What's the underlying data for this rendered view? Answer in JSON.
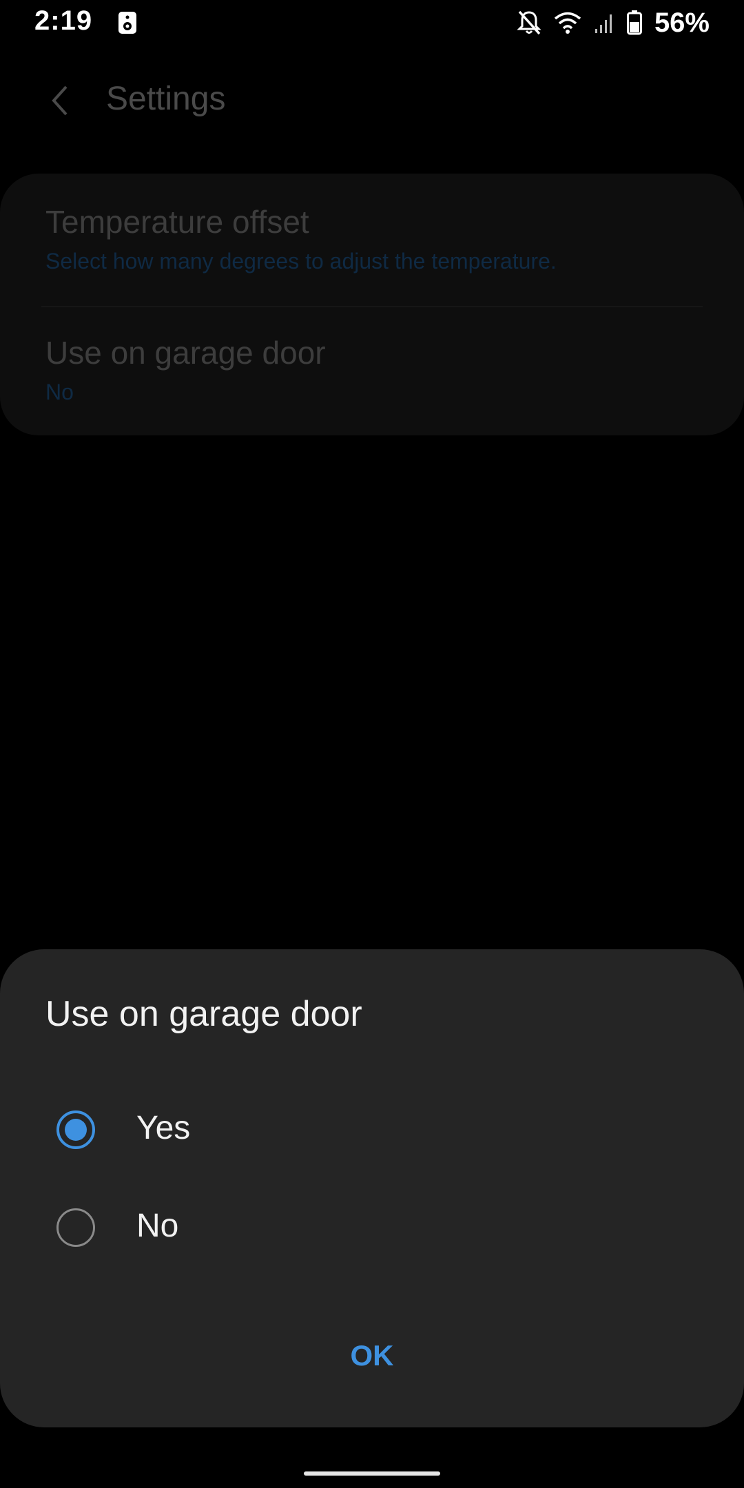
{
  "status_bar": {
    "time": "2:19",
    "battery_percent": "56%",
    "icons": [
      "speaker-icon",
      "bell-off-icon",
      "wifi-icon",
      "signal-icon",
      "battery-icon"
    ]
  },
  "header": {
    "title": "Settings"
  },
  "settings": {
    "items": [
      {
        "title": "Temperature offset",
        "subtitle": "Select how many degrees to adjust the temperature."
      },
      {
        "title": "Use on garage door",
        "subtitle": "No"
      }
    ]
  },
  "dialog": {
    "title": "Use on garage door",
    "options": [
      {
        "label": "Yes",
        "selected": true
      },
      {
        "label": "No",
        "selected": false
      }
    ],
    "ok_label": "OK"
  },
  "colors": {
    "accent": "#3e91e0",
    "dialog_bg": "#252525",
    "background": "#000000"
  }
}
